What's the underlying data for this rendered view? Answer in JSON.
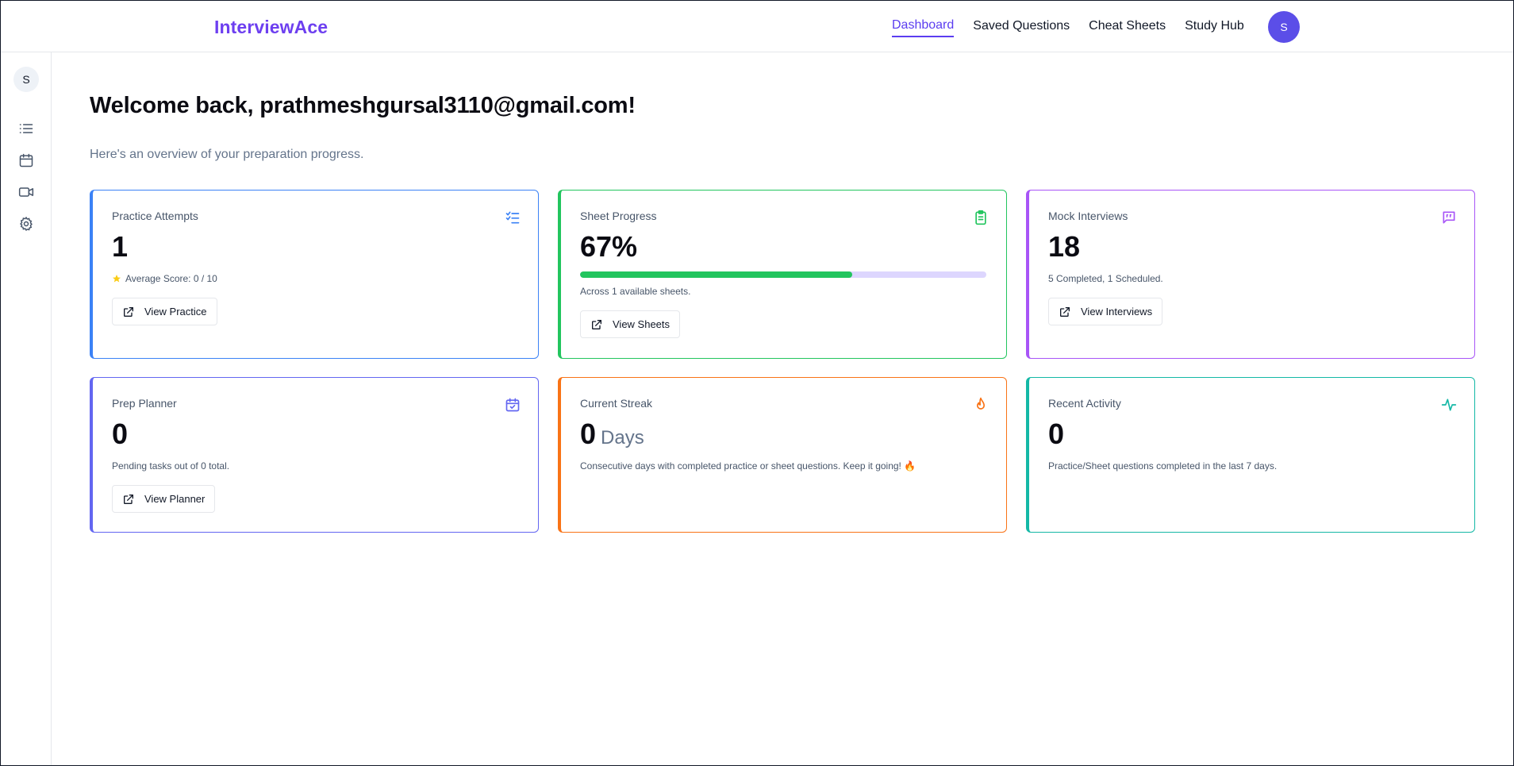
{
  "header": {
    "logo": "InterviewAce",
    "nav": [
      {
        "label": "Dashboard",
        "active": true
      },
      {
        "label": "Saved Questions",
        "active": false
      },
      {
        "label": "Cheat Sheets",
        "active": false
      },
      {
        "label": "Study Hub",
        "active": false
      }
    ],
    "avatar_initial": "S"
  },
  "sidebar": {
    "avatar_initial": "S",
    "items": [
      {
        "icon": "list-icon"
      },
      {
        "icon": "calendar-icon"
      },
      {
        "icon": "video-icon"
      },
      {
        "icon": "gear-icon"
      }
    ]
  },
  "main": {
    "welcome": "Welcome back, prathmeshgursal3110@gmail.com!",
    "subtitle": "Here's an overview of your preparation progress."
  },
  "cards": {
    "practice": {
      "title": "Practice Attempts",
      "value": "1",
      "note": "Average Score: 0 / 10",
      "button": "View Practice",
      "icon": "checklist-icon",
      "color": "#3b82f6"
    },
    "sheet": {
      "title": "Sheet Progress",
      "value": "67%",
      "progress_percent": 67,
      "note": "Across 1 available sheets.",
      "button": "View Sheets",
      "icon": "clipboard-icon",
      "color": "#22c55e"
    },
    "mock": {
      "title": "Mock Interviews",
      "value": "18",
      "note": "5 Completed, 1 Scheduled.",
      "button": "View Interviews",
      "icon": "message-icon",
      "color": "#a855f7"
    },
    "planner": {
      "title": "Prep Planner",
      "value": "0",
      "note": "Pending tasks out of 0 total.",
      "button": "View Planner",
      "icon": "calendar-check-icon",
      "color": "#6366f1"
    },
    "streak": {
      "title": "Current Streak",
      "value": "0",
      "unit": "Days",
      "note": "Consecutive days with completed practice or sheet questions. Keep it going! 🔥",
      "icon": "flame-icon",
      "color": "#f97316"
    },
    "activity": {
      "title": "Recent Activity",
      "value": "0",
      "note": "Practice/Sheet questions completed in the last 7 days.",
      "icon": "activity-icon",
      "color": "#14b8a6"
    }
  }
}
